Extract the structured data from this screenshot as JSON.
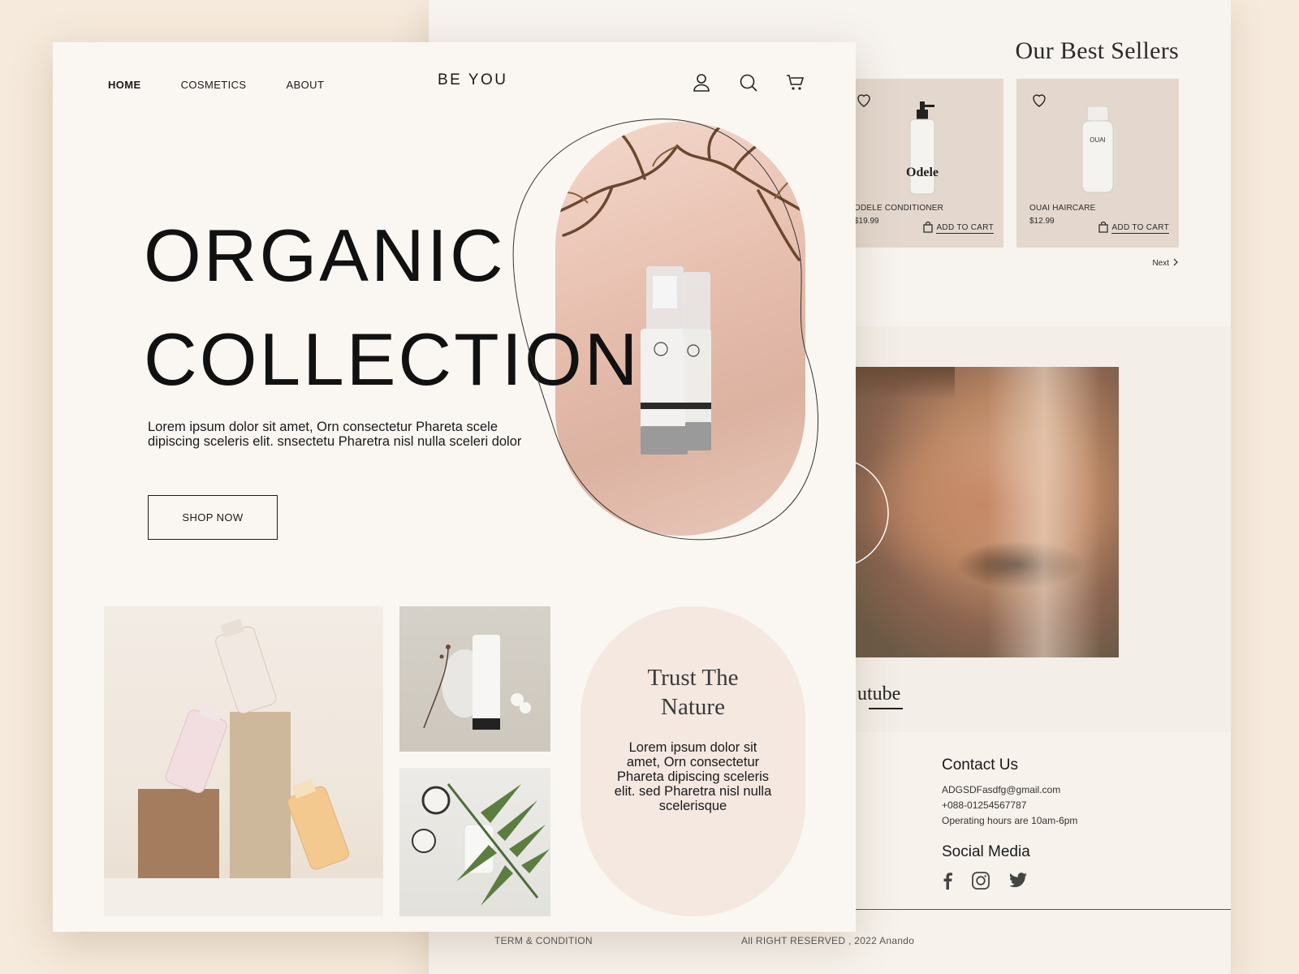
{
  "back_page": {
    "best_sellers_title": "Our Best Sellers",
    "products": [
      {
        "name": "ODELE CONDITIONER",
        "price": "$19.99",
        "add_to_cart": "ADD TO CART",
        "bottle_label": "Odele"
      },
      {
        "name": "OUAI HAIRCARE",
        "price": "$12.99",
        "add_to_cart": "ADD TO CART",
        "bottle_label": "OUAI"
      }
    ],
    "next_label": "Next",
    "youtube_label": "utube",
    "contact": {
      "title": "Contact Us",
      "email": "ADGSDFasdfg@gmail.com",
      "phone": "+088-01254567787",
      "hours": "Operating hours are 10am-6pm"
    },
    "social": {
      "title": "Social Media",
      "icons": [
        "facebook-icon",
        "instagram-icon",
        "twitter-icon"
      ]
    },
    "footer": {
      "terms": "TERM & CONDITION",
      "copyright": "All RIGHT RESERVED , 2022 Anando"
    }
  },
  "front_page": {
    "nav": {
      "items": [
        "HOME",
        "COSMETICS",
        "ABOUT"
      ],
      "active": "HOME"
    },
    "brand": "BE YOU",
    "header_icons": [
      "user-icon",
      "search-icon",
      "cart-icon"
    ],
    "hero": {
      "title_line1": "ORGANIC",
      "title_line2": "COLLECTION",
      "description": "Lorem ipsum dolor sit amet, Orn consectetur Phareta scele dipiscing sceleris elit. snsectetu Pharetra nisl nulla sceleri dolor",
      "cta": "SHOP NOW"
    },
    "trust_card": {
      "title_line1": "Trust The",
      "title_line2": "Nature",
      "text": "Lorem ipsum dolor sit amet, Orn consectetur Phareta dipiscing sceleris elit. sed Pharetra nisl nulla scelerisque"
    }
  },
  "colors": {
    "background": "#f6eadc",
    "front_page": "#faf7f2",
    "back_page": "#f7f3ef",
    "product_card": "#e4d8ce",
    "trust_card": "#f4e8e1",
    "text": "#1a1a1a"
  }
}
